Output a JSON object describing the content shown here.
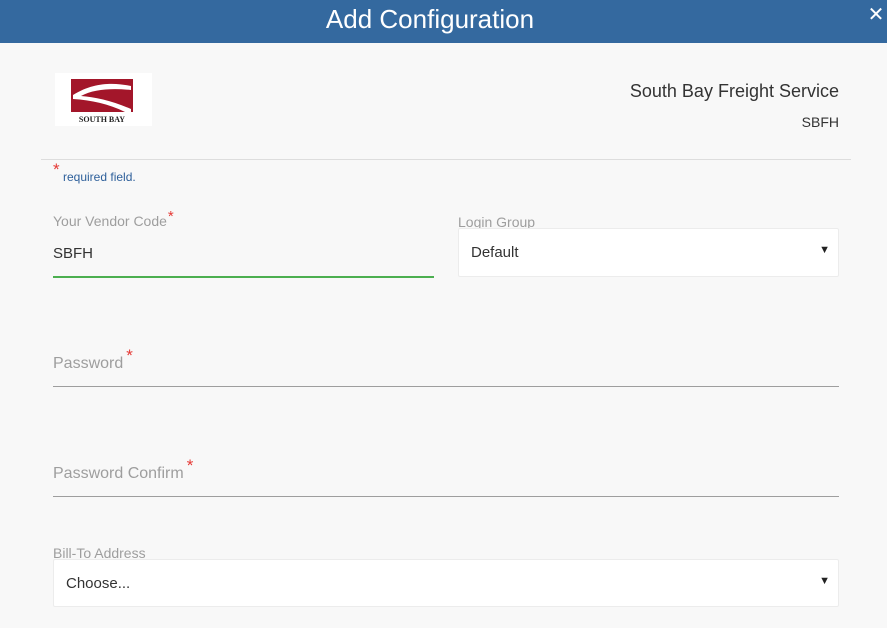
{
  "dialog": {
    "title": "Add Configuration",
    "close_glyph": "✕"
  },
  "vendor": {
    "logo_text": "SOUTH BAY",
    "name": "South Bay Freight Service",
    "code": "SBFH",
    "brand_color": "#a3162a"
  },
  "form": {
    "required_star": "*",
    "required_note": "required field.",
    "vendor_code": {
      "label": "Your Vendor Code",
      "value": "SBFH"
    },
    "login_group": {
      "label": "Login Group",
      "selected": "Default"
    },
    "password": {
      "label": "Password",
      "value": ""
    },
    "password_confirm": {
      "label": "Password Confirm",
      "value": ""
    },
    "bill_to": {
      "label": "Bill-To Address",
      "selected": "Choose..."
    },
    "dropdown_arrow": "▼"
  },
  "colors": {
    "header": "#34699f",
    "accent_valid": "#4caf50",
    "required": "#e53935"
  }
}
